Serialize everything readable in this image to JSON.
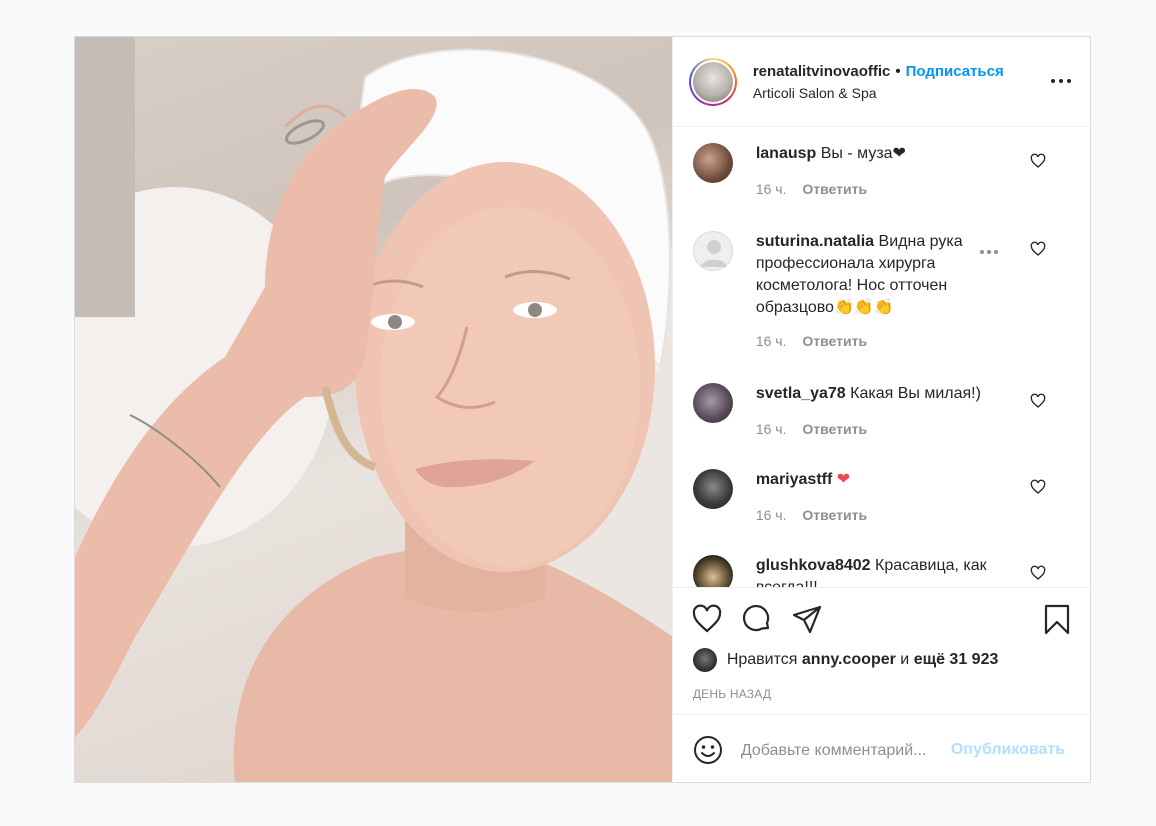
{
  "post": {
    "photo_alt": "",
    "header": {
      "username": "renatalitvinovaoffic",
      "separator": "•",
      "follow_label": "Подписаться",
      "location": "Articoli Salon & Spa"
    },
    "comments": [
      {
        "username": "lanausp",
        "text": "Вы - муза❤",
        "time": "16 ч.",
        "reply": "Ответить"
      },
      {
        "username": "suturina.natalia",
        "text": "Видна рука профессионала хирурга косметолога! Нос отточен образцово👏👏👏",
        "time": "16 ч.",
        "reply": "Ответить"
      },
      {
        "username": "svetla_ya78",
        "text": "Какая Вы милая!)",
        "time": "16 ч.",
        "reply": "Ответить"
      },
      {
        "username": "mariyastff",
        "text": "❤",
        "time": "16 ч.",
        "reply": "Ответить"
      },
      {
        "username": "glushkova8402",
        "text": "Красавица, как всегда!!!",
        "time": "",
        "reply": ""
      }
    ],
    "likes": {
      "prefix": "Нравится",
      "liker": "anny.cooper",
      "conj": "и",
      "others": "ещё 31 923"
    },
    "date": "ДЕНЬ НАЗАД",
    "add_comment": {
      "placeholder": "Добавьте комментарий...",
      "publish_label": "Опубликовать"
    }
  },
  "colors": {
    "accent": "#0095f6",
    "publish_disabled": "#b2dffc",
    "heart_red": "#ed4956",
    "muted": "#8e8e8e"
  },
  "icons": {
    "like": "heart-icon",
    "comment": "comment-bubble-icon",
    "share": "paper-plane-icon",
    "save": "bookmark-icon",
    "more": "ellipsis-icon",
    "emoji": "smile-icon"
  }
}
